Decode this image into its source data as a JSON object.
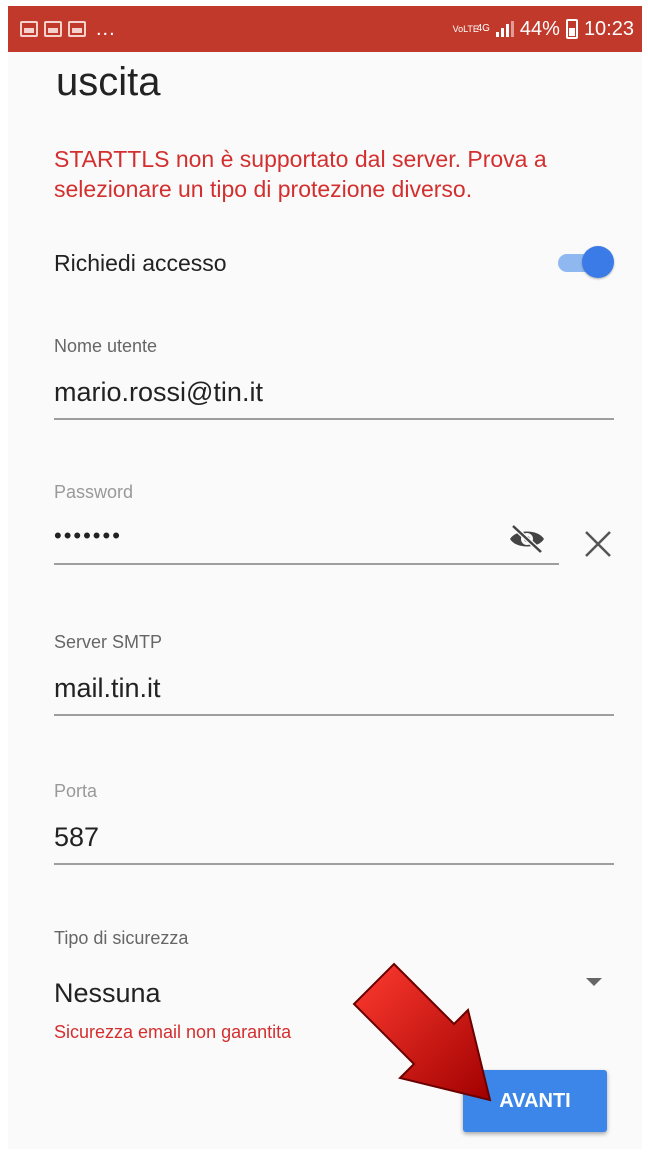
{
  "status_bar": {
    "overflow_indicator": "...",
    "network_volte": "VoLTE",
    "network_type": "4G",
    "battery_percent": "44%",
    "time": "10:23"
  },
  "page": {
    "heading": "uscita",
    "error_message": "STARTTLS non è supportato dal server. Prova a selezionare un tipo di protezione diverso."
  },
  "require_login": {
    "label": "Richiedi accesso",
    "enabled": true
  },
  "username": {
    "label": "Nome utente",
    "value": "mario.rossi@tin.it"
  },
  "password": {
    "label": "Password",
    "value": "•••••••"
  },
  "smtp_server": {
    "label": "Server SMTP",
    "value": "mail.tin.it"
  },
  "port": {
    "label": "Porta",
    "value": "587"
  },
  "security": {
    "label": "Tipo di sicurezza",
    "selected": "Nessuna",
    "warning": "Sicurezza email non garantita"
  },
  "actions": {
    "next_label": "AVANTI"
  },
  "colors": {
    "status_bar": "#c0392b",
    "error": "#d32f2f",
    "accent": "#3b86e8",
    "annotation_arrow": "#cc0000"
  }
}
